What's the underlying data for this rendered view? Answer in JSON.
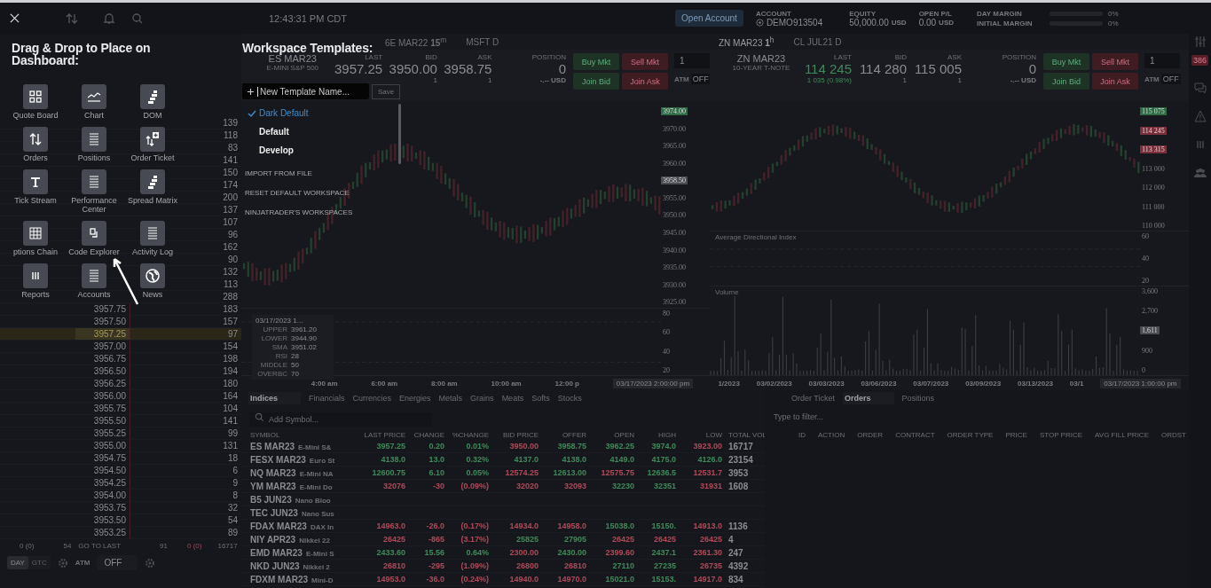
{
  "top_bar": {
    "time": "12:43:31 PM CDT",
    "open_account": "Open Account",
    "account": {
      "label": "ACCOUNT",
      "value": "DEMO913504"
    },
    "equity": {
      "label": "EQUITY",
      "value": "50,000.00",
      "unit": "USD"
    },
    "open_pl": {
      "label": "OPEN P/L",
      "value": "0.00",
      "unit": "USD"
    },
    "margins": [
      {
        "label": "DAY MARGIN",
        "value": "0%",
        "level": 0
      },
      {
        "label": "INITIAL MARGIN",
        "value": "0%",
        "level": 0
      }
    ]
  },
  "sidebar": {
    "badge": "386"
  },
  "dashboard_panel": {
    "title": "Drag & Drop to Place on Dashboard:",
    "tiles": [
      {
        "label": "Quote Board",
        "kind": "grid"
      },
      {
        "label": "Chart",
        "kind": "chart"
      },
      {
        "label": "DOM",
        "kind": "dom"
      },
      {
        "label": "Orders",
        "kind": "arrows"
      },
      {
        "label": "Positions",
        "kind": "list"
      },
      {
        "label": "Order Ticket",
        "kind": "ticket"
      },
      {
        "label": "Tick Stream",
        "kind": "text"
      },
      {
        "label": "Performance Center",
        "kind": "list"
      },
      {
        "label": "Spread Matrix",
        "kind": "dom"
      },
      {
        "label": "ptions Chain",
        "kind": "table"
      },
      {
        "label": "Code Explorer",
        "kind": "code"
      },
      {
        "label": "Activity Log",
        "kind": "list"
      },
      {
        "label": "Reports",
        "kind": "columns"
      },
      {
        "label": "Accounts",
        "kind": "list"
      },
      {
        "label": "News",
        "kind": "globe"
      }
    ]
  },
  "templates_panel": {
    "title": "Workspace Templates:",
    "name_field": {
      "placeholder": "New Template Name..."
    },
    "save": {
      "label": "Save",
      "disabled": true
    },
    "items": [
      {
        "label": "Dark Default",
        "selected": true
      },
      {
        "label": "Default",
        "selected": false
      },
      {
        "label": "Develop",
        "selected": false
      }
    ],
    "links": [
      "IMPORT FROM FILE",
      "RESET DEFAULT WORKSPACE",
      "NINJATRADER'S WORKSPACES"
    ]
  },
  "dom": {
    "rows": [
      {
        "volume": "139",
        "current": false
      },
      {
        "volume": "118",
        "current": false
      },
      {
        "volume": "83",
        "current": false
      },
      {
        "volume": "141",
        "current": false
      },
      {
        "volume": "150",
        "current": false
      },
      {
        "volume": "174",
        "current": false
      },
      {
        "volume": "200",
        "current": false
      },
      {
        "volume": "137",
        "current": false
      },
      {
        "volume": "107",
        "current": false
      },
      {
        "volume": "96",
        "current": false
      },
      {
        "volume": "162",
        "current": false
      },
      {
        "volume": "90",
        "current": false
      },
      {
        "volume": "132",
        "current": false
      },
      {
        "volume": "113",
        "current": false
      },
      {
        "volume": "288",
        "current": false
      },
      {
        "price": "3957.75",
        "volume": "183",
        "current": false
      },
      {
        "price": "3957.50",
        "volume": "157",
        "current": false
      },
      {
        "price": "3957.25",
        "volume": "97",
        "current": true
      },
      {
        "price": "3957.00",
        "volume": "154",
        "current": false
      },
      {
        "price": "3956.75",
        "volume": "198",
        "current": false
      },
      {
        "price": "3956.50",
        "volume": "194",
        "current": false
      },
      {
        "price": "3956.25",
        "volume": "180",
        "current": false
      },
      {
        "price": "3956.00",
        "volume": "164",
        "current": false
      },
      {
        "price": "3955.75",
        "volume": "104",
        "current": false
      },
      {
        "price": "3955.50",
        "volume": "141",
        "current": false
      },
      {
        "price": "3955.25",
        "volume": "99",
        "current": false
      },
      {
        "price": "3955.00",
        "volume": "131",
        "current": false
      },
      {
        "price": "3954.75",
        "volume": "18",
        "current": false
      },
      {
        "price": "3954.50",
        "volume": "6",
        "current": false
      },
      {
        "price": "3954.25",
        "volume": "9",
        "current": false
      },
      {
        "price": "3954.00",
        "volume": "8",
        "current": false
      },
      {
        "price": "3953.75",
        "volume": "32",
        "current": false
      },
      {
        "price": "3953.50",
        "volume": "54",
        "current": false
      },
      {
        "price": "3953.25",
        "volume": "89",
        "current": false
      }
    ],
    "footer": [
      "0 (0)",
      "54",
      "GO TO LAST",
      "91",
      "0 (0)",
      "16717"
    ],
    "tif": [
      {
        "label": "DAY",
        "selected": true
      },
      {
        "label": "GTC",
        "selected": false
      }
    ],
    "atm": {
      "label": "ATM",
      "value": "OFF"
    }
  },
  "charts": [
    {
      "tabs": [
        {
          "label": "6E MAR22 **15**$^{m}$",
          "selected": false
        },
        {
          "label": "MSFT D",
          "selected": false
        }
      ],
      "symbol": "ES MAR23",
      "description": "E-MINI S&P 500",
      "quotes": [
        {
          "label": "LAST",
          "value": "3957.25"
        },
        {
          "label": "BID",
          "value": "3950.00",
          "sub": "1"
        },
        {
          "label": "ASK",
          "value": "3958.75",
          "sub": "1"
        }
      ],
      "position": {
        "label": "POSITION",
        "value": "0",
        "sub": "-.-- USD"
      },
      "buttons": [
        {
          "label": "Buy Mkt",
          "kind": "buy"
        },
        {
          "label": "Sell Mkt",
          "kind": "sell"
        },
        {
          "label": "Join Bid",
          "kind": "buy"
        },
        {
          "label": "Join Ask",
          "kind": "sell"
        }
      ],
      "qty": "1",
      "atm": {
        "label": "ATM",
        "value": "OFF"
      },
      "panes": [
        {
          "kind": "candles",
          "ticks": [
            {
              "text": "3974.00",
              "color": "#2f6a45"
            },
            {
              "text": "3970.00"
            },
            {
              "text": "3965.00"
            },
            {
              "text": "3960.00"
            },
            {
              "text": "3958.50",
              "color": "#4a4c53"
            },
            {
              "text": "3955.00"
            },
            {
              "text": "3950.00"
            },
            {
              "text": "3945.00"
            },
            {
              "text": "3940.00"
            },
            {
              "text": "3935.00"
            },
            {
              "text": "3930.00"
            },
            {
              "text": "3925.00"
            }
          ]
        },
        {
          "kind": "oscillator",
          "ticks": [
            {
              "text": "80"
            },
            {
              "text": "60"
            },
            {
              "text": "40"
            },
            {
              "text": "20"
            }
          ]
        }
      ],
      "dates": [
        "4:00 am",
        "6:00 am",
        "8:00 am",
        "10:00 am",
        "12:00 p"
      ],
      "cursor_date": "03/17/2023 2:00:00 pm",
      "tooltip": {
        "title": "03/17/2023 1...",
        "rows": [
          {
            "label": "UPPER",
            "value": "3961.20"
          },
          {
            "label": "LOWER",
            "value": "3944.90"
          },
          {
            "label": "SMA",
            "value": "3951.02"
          },
          {
            "label": "RSI",
            "value": "28"
          },
          {
            "label": "MIDDLE",
            "value": "50"
          },
          {
            "label": "OVERBC",
            "value": "70"
          }
        ]
      }
    },
    {
      "tabs": [
        {
          "label": "ZN MAR23 **1**$^{h}$",
          "selected": true
        },
        {
          "label": "CL JUL21 D",
          "selected": false
        }
      ],
      "symbol": "ZN MAR23",
      "description": "10-YEAR T-NOTE",
      "quotes": [
        {
          "label": "LAST",
          "value": "114 245",
          "sub": "1 035 (0.98%)",
          "color": "#3f8a5a"
        },
        {
          "label": "BID",
          "value": "114 280",
          "sub": "1"
        },
        {
          "label": "ASK",
          "value": "115 005",
          "sub": "1"
        }
      ],
      "position": {
        "label": "POSITION",
        "value": "0",
        "sub": "-.-- USD"
      },
      "buttons": [
        {
          "label": "Buy Mkt",
          "kind": "buy"
        },
        {
          "label": "Sell Mkt",
          "kind": "sell"
        },
        {
          "label": "Join Bid",
          "kind": "buy"
        },
        {
          "label": "Join Ask",
          "kind": "sell"
        }
      ],
      "qty": "1",
      "atm": {
        "label": "ATM",
        "value": "OFF"
      },
      "panes": [
        {
          "kind": "candles",
          "ticks": [
            {
              "text": "115 075",
              "color": "#2f6a45"
            },
            {
              "text": "114 245",
              "color": "#7a2f3b"
            },
            {
              "text": "113 315",
              "color": "#7a2f3b"
            },
            {
              "text": "113 000"
            },
            {
              "text": "112 000"
            },
            {
              "text": "111 000"
            },
            {
              "text": "110 000"
            }
          ]
        },
        {
          "kind": "adx",
          "label": "Average Directional Index",
          "ticks": [
            {
              "text": "60"
            },
            {
              "text": "40"
            },
            {
              "text": "20"
            }
          ]
        },
        {
          "kind": "volume",
          "label": "Volume",
          "ticks": [
            {
              "text": "3,600"
            },
            {
              "text": "2,700"
            },
            {
              "text": "1,611",
              "color": "#4a4c53"
            },
            {
              "text": "900"
            },
            {
              "text": "0"
            }
          ]
        }
      ],
      "dates": [
        "1/2023",
        "03/02/2023",
        "03/03/2023",
        "03/06/2023",
        "03/07/2023",
        "03/09/2023",
        "03/13/2023",
        "03/1"
      ],
      "cursor_date": "03/17/2023 1:00:00 pm"
    }
  ],
  "quotes_panel": {
    "tabs": [
      {
        "label": "Indices",
        "selected": true
      },
      {
        "label": "Financials",
        "selected": false
      },
      {
        "label": "Currencies",
        "selected": false
      },
      {
        "label": "Energies",
        "selected": false
      },
      {
        "label": "Metals",
        "selected": false
      },
      {
        "label": "Grains",
        "selected": false
      },
      {
        "label": "Meats",
        "selected": false
      },
      {
        "label": "Softs",
        "selected": false
      },
      {
        "label": "Stocks",
        "selected": false
      }
    ],
    "search": {
      "placeholder": "Add Symbol..."
    },
    "columns": [
      "SYMBOL",
      "LAST PRICE",
      "CHANGE",
      "%CHANGE",
      "BID PRICE",
      "OFFER",
      "OPEN",
      "HIGH",
      "LOW",
      "TOTAL VOL"
    ],
    "rows": [
      {
        "symbol": "ES MAR23",
        "description": "E-Mini S&",
        "cells": [
          {
            "text": "3957.25",
            "color": "#3f8a5a"
          },
          {
            "text": "0.20",
            "color": "#3f8a5a"
          },
          {
            "text": "0.01%",
            "color": "#3f8a5a"
          },
          {
            "text": "3950.00",
            "color": "#b04a5a"
          },
          {
            "text": "3958.75",
            "color": "#3f8a5a"
          },
          {
            "text": "3962.25",
            "color": "#3f8a5a"
          },
          {
            "text": "3974.0",
            "color": "#3f8a5a"
          },
          {
            "text": "3923.00",
            "color": "#b04a5a"
          }
        ],
        "volume": "16717"
      },
      {
        "symbol": "FESX MAR23",
        "description": "Euro St",
        "cells": [
          {
            "text": "4138.0",
            "color": "#3f8a5a"
          },
          {
            "text": "13.0",
            "color": "#3f8a5a"
          },
          {
            "text": "0.32%",
            "color": "#3f8a5a"
          },
          {
            "text": "4137.0",
            "color": "#3f8a5a"
          },
          {
            "text": "4138.0",
            "color": "#3f8a5a"
          },
          {
            "text": "4149.0",
            "color": "#3f8a5a"
          },
          {
            "text": "4175.0",
            "color": "#3f8a5a"
          },
          {
            "text": "4126.0",
            "color": "#3f8a5a"
          }
        ],
        "volume": "23154"
      },
      {
        "symbol": "NQ MAR23",
        "description": "E-Mini NA",
        "cells": [
          {
            "text": "12600.75",
            "color": "#3f8a5a"
          },
          {
            "text": "6.10",
            "color": "#3f8a5a"
          },
          {
            "text": "0.05%",
            "color": "#3f8a5a"
          },
          {
            "text": "12574.25",
            "color": "#b04a5a"
          },
          {
            "text": "12613.00",
            "color": "#3f8a5a"
          },
          {
            "text": "12575.75",
            "color": "#b04a5a"
          },
          {
            "text": "12636.5",
            "color": "#3f8a5a"
          },
          {
            "text": "12531.7",
            "color": "#b04a5a"
          }
        ],
        "volume": "3953"
      },
      {
        "symbol": "YM MAR23",
        "description": "E-Mini Do",
        "cells": [
          {
            "text": "32076",
            "color": "#b04a5a"
          },
          {
            "text": "-30",
            "color": "#b04a5a"
          },
          {
            "text": "(0.09%)",
            "color": "#b04a5a"
          },
          {
            "text": "32020",
            "color": "#b04a5a"
          },
          {
            "text": "32093",
            "color": "#b04a5a"
          },
          {
            "text": "32230",
            "color": "#3f8a5a"
          },
          {
            "text": "32351",
            "color": "#3f8a5a"
          },
          {
            "text": "31931",
            "color": "#b04a5a"
          }
        ],
        "volume": "1608"
      },
      {
        "symbol": "B5 JUN23",
        "description": "Nano Bloo"
      },
      {
        "symbol": "TEC JUN23",
        "description": "Nano Sus"
      },
      {
        "symbol": "FDAX MAR23",
        "description": "DAX In",
        "cells": [
          {
            "text": "14963.0",
            "color": "#b04a5a"
          },
          {
            "text": "-26.0",
            "color": "#b04a5a"
          },
          {
            "text": "(0.17%)",
            "color": "#b04a5a"
          },
          {
            "text": "14934.0",
            "color": "#b04a5a"
          },
          {
            "text": "14958.0",
            "color": "#b04a5a"
          },
          {
            "text": "15038.0",
            "color": "#3f8a5a"
          },
          {
            "text": "15150.",
            "color": "#3f8a5a"
          },
          {
            "text": "14913.0",
            "color": "#b04a5a"
          }
        ],
        "volume": "1136"
      },
      {
        "symbol": "NIY APR23",
        "description": "Nikkei 22",
        "cells": [
          {
            "text": "26425",
            "color": "#b04a5a"
          },
          {
            "text": "-865",
            "color": "#b04a5a"
          },
          {
            "text": "(3.17%)",
            "color": "#b04a5a"
          },
          {
            "text": "25825",
            "color": "#3f8a5a"
          },
          {
            "text": "27905",
            "color": "#3f8a5a"
          },
          {
            "text": "26425",
            "color": "#b04a5a"
          },
          {
            "text": "26425",
            "color": "#b04a5a"
          },
          {
            "text": "26425",
            "color": "#b04a5a"
          }
        ],
        "volume": "4"
      },
      {
        "symbol": "EMD MAR23",
        "description": "E-Mini S",
        "cells": [
          {
            "text": "2433.60",
            "color": "#3f8a5a"
          },
          {
            "text": "15.56",
            "color": "#3f8a5a"
          },
          {
            "text": "0.64%",
            "color": "#3f8a5a"
          },
          {
            "text": "2300.00",
            "color": "#b04a5a"
          },
          {
            "text": "2430.00",
            "color": "#3f8a5a"
          },
          {
            "text": "2399.60",
            "color": "#b04a5a"
          },
          {
            "text": "2437.1",
            "color": "#3f8a5a"
          },
          {
            "text": "2361.30",
            "color": "#b04a5a"
          }
        ],
        "volume": "247"
      },
      {
        "symbol": "NKD JUN23",
        "description": "Nikkei 2",
        "cells": [
          {
            "text": "26810",
            "color": "#b04a5a"
          },
          {
            "text": "-295",
            "color": "#b04a5a"
          },
          {
            "text": "(1.09%)",
            "color": "#b04a5a"
          },
          {
            "text": "26800",
            "color": "#b04a5a"
          },
          {
            "text": "26810",
            "color": "#b04a5a"
          },
          {
            "text": "27110",
            "color": "#3f8a5a"
          },
          {
            "text": "27235",
            "color": "#3f8a5a"
          },
          {
            "text": "26735",
            "color": "#b04a5a"
          }
        ],
        "volume": "4392"
      },
      {
        "symbol": "FDXM MAR23",
        "description": "Mini-D",
        "cells": [
          {
            "text": "14953.0",
            "color": "#b04a5a"
          },
          {
            "text": "-36.0",
            "color": "#b04a5a"
          },
          {
            "text": "(0.24%)",
            "color": "#b04a5a"
          },
          {
            "text": "14940.0",
            "color": "#b04a5a"
          },
          {
            "text": "14970.0",
            "color": "#b04a5a"
          },
          {
            "text": "15021.0",
            "color": "#3f8a5a"
          },
          {
            "text": "15153.",
            "color": "#3f8a5a"
          },
          {
            "text": "14917.0",
            "color": "#b04a5a"
          }
        ],
        "volume": "834"
      }
    ]
  },
  "orders_panel": {
    "tabs": [
      {
        "label": "Order Ticket",
        "selected": false
      },
      {
        "label": "Orders",
        "selected": true
      },
      {
        "label": "Positions",
        "selected": false
      }
    ],
    "filter": {
      "placeholder": "Type to filter..."
    },
    "columns": [
      "ID",
      "ACTION",
      "ORDER",
      "CONTRACT",
      "ORDER TYPE",
      "PRICE",
      "STOP PRICE",
      "AVG FILL PRICE",
      "ORDST"
    ]
  }
}
